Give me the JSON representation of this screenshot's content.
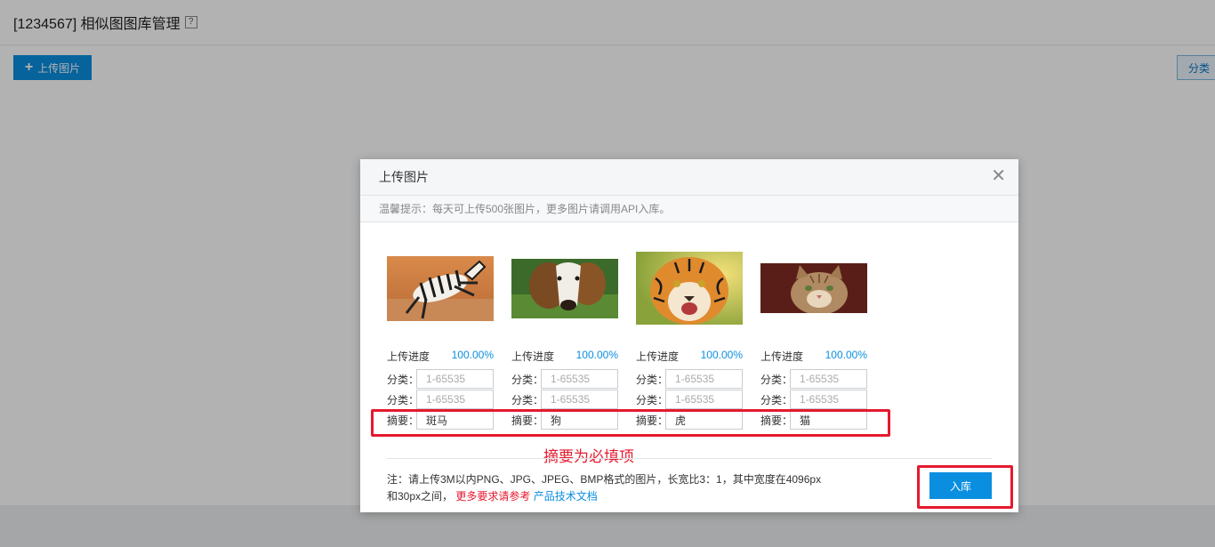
{
  "page": {
    "title": "[1234567] 相似图图库管理",
    "help_label": "?",
    "upload_label": "上传图片",
    "class_label": "分类"
  },
  "dialog": {
    "title": "上传图片",
    "tip": "温馨提示：每天可上传500张图片，更多图片请调用API入库。",
    "progress_label": "上传进度",
    "class_label": "分类：",
    "summary_label": "摘要：",
    "placeholder": "1-65535",
    "cards": [
      {
        "image_icon": "zebra-photo",
        "progress": "100.00%",
        "summary": "斑马"
      },
      {
        "image_icon": "dog-photo",
        "progress": "100.00%",
        "summary": "狗"
      },
      {
        "image_icon": "tiger-photo",
        "progress": "100.00%",
        "summary": "虎"
      },
      {
        "image_icon": "cat-photo",
        "progress": "100.00%",
        "summary": "猫"
      }
    ],
    "annotation": "摘要为必填项",
    "note_line1": "注：请上传3M以内PNG、JPG、JPEG、BMP格式的图片，长宽比3：1，其中宽度在4096px",
    "note_line2_prefix": "和30px之间，",
    "note_red": "更多要求请参考",
    "note_link": "产品技术文档",
    "submit_label": "入库"
  }
}
